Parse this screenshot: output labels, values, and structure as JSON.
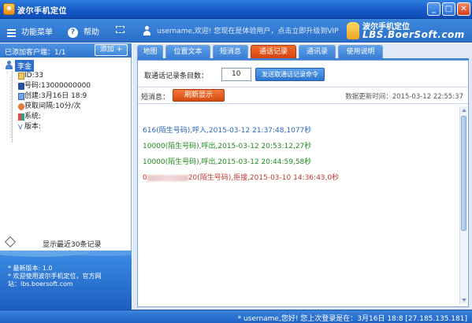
{
  "window": {
    "title": "波尔手机定位",
    "min_label": "_",
    "max_label": "□",
    "close_label": "✕"
  },
  "toolbar": {
    "menu_label": "功能菜单",
    "help_label": "帮助",
    "welcome": "username,欢迎! 您现在是体验用户，点击立即升级到VIP",
    "logo_line1": "波尔手机定位",
    "logo_line2": "LBS.BoerSoft.com"
  },
  "sidebar": {
    "count_label": "已添加客户端：1/1",
    "add_button": "添加 +",
    "client_name": "李金",
    "items": [
      {
        "label": "ID:33",
        "icon": "id-card-icon"
      },
      {
        "label": "号码:13000000000",
        "icon": "phone-icon"
      },
      {
        "label": "创建:3月16日 18:9",
        "icon": "calendar-icon"
      },
      {
        "label": "获取间隔:10分/次",
        "icon": "interval-icon"
      },
      {
        "label": "系统:",
        "icon": "windows-icon"
      },
      {
        "label": "版本:",
        "icon": "version-icon"
      }
    ],
    "recent_link": "显示最近30条记录",
    "info_lines": [
      "* 最新版本: 1.0",
      "* 欢迎使用波尔手机定位，官方网",
      "站：lbs.boersoft.com"
    ]
  },
  "tabs": [
    {
      "label": "地图",
      "active": false
    },
    {
      "label": "位置文本",
      "active": false
    },
    {
      "label": "短消息",
      "active": false
    },
    {
      "label": "通话记录",
      "active": true
    },
    {
      "label": "通讯录",
      "active": false
    },
    {
      "label": "使用说明",
      "active": false
    }
  ],
  "call_log": {
    "count_label": "取通话记录条目数：",
    "count_value": "10",
    "send_button": "发送取通话记录命令",
    "sms_label": "短消息：",
    "refresh_button": "刷新显示",
    "update_time": "数据更新时间：2015-03-12 22:55:37",
    "records": [
      {
        "text": "616(陌生号码),呼入,2015-03-12 21:37:48,1077秒",
        "color": "#2a66b8"
      },
      {
        "text": "10000(陌生号码),呼出,2015-03-12 20:53:12,27秒",
        "color": "#1f8a1f"
      },
      {
        "text": "10000(陌生号码),呼出,2015-03-12 20:44:59,58秒",
        "color": "#1f8a1f"
      },
      {
        "text_prefix": "0",
        "text_suffix": "20(陌生号码),拒接,2015-03-10 14:36:43,0秒",
        "color": "#c0392b"
      }
    ]
  },
  "statusbar": {
    "text": "* username,您好! 您上次登录是在：3月16日 18:8  [27.185.135.181]"
  },
  "colors": {
    "accent": "#2a6ec9",
    "active_tab": "#d8420f",
    "incoming": "#2a66b8",
    "outgoing": "#1f8a1f",
    "rejected": "#c0392b"
  }
}
